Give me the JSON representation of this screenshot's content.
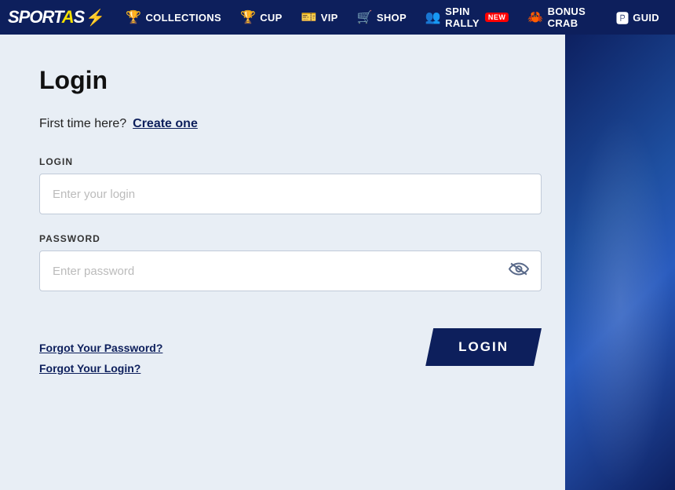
{
  "navbar": {
    "logo": "SPORTAS",
    "logo_lightning": "⚡",
    "items": [
      {
        "id": "collections",
        "label": "COLLECTIONS",
        "icon": "🏆"
      },
      {
        "id": "cup",
        "label": "CUP",
        "icon": "🏆"
      },
      {
        "id": "vip",
        "label": "VIP",
        "icon": "🎫"
      },
      {
        "id": "shop",
        "label": "SHOP",
        "icon": "🛒"
      },
      {
        "id": "spin-rally",
        "label": "SPIN RALLY",
        "icon": "👥",
        "badge": "NEW"
      },
      {
        "id": "bonus-crab",
        "label": "BONUS CRAB",
        "icon": "🦀"
      },
      {
        "id": "guide",
        "label": "GUID",
        "icon": "🅿"
      }
    ]
  },
  "page": {
    "title": "Login",
    "first_time_text": "First time here?",
    "create_one_label": "Create one",
    "login_label": "LOGIN",
    "password_label": "PASSWORD",
    "login_input_placeholder": "Enter your login",
    "password_input_placeholder": "Enter password",
    "forgot_password": "Forgot Your Password?",
    "forgot_login": "Forgot Your Login?",
    "login_button_label": "LOGIN"
  }
}
